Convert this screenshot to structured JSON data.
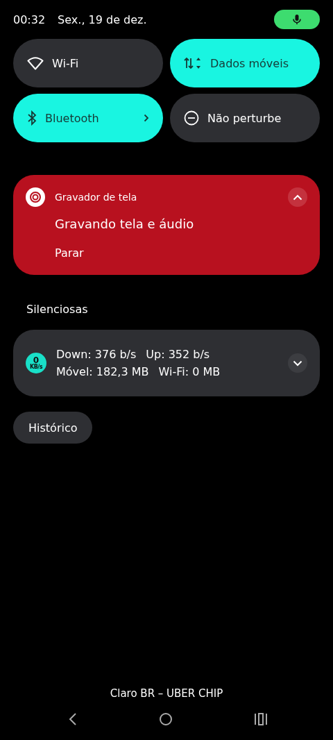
{
  "status_bar": {
    "time": "00:32",
    "date": "Sex., 19 de dez.",
    "mic_active": true
  },
  "tiles": [
    {
      "kind": "wifi",
      "label": "Wi-Fi",
      "on": false,
      "chevron": false
    },
    {
      "kind": "data",
      "label": "Dados móveis",
      "on": true,
      "chevron": false
    },
    {
      "kind": "bluetooth",
      "label": "Bluetooth",
      "on": true,
      "chevron": true
    },
    {
      "kind": "dnd",
      "label": "Não perturbe",
      "on": false,
      "chevron": false
    }
  ],
  "recording_notification": {
    "app": "Gravador de tela",
    "title": "Gravando tela e áudio",
    "action": "Parar",
    "expanded": true
  },
  "section_title": "Silenciosas",
  "speed_notification": {
    "badge_value": "0",
    "badge_unit": "KB/s",
    "line_1": [
      "Down: 376 b/s",
      "Up: 352 b/s"
    ],
    "line_2": [
      "Móvel: 182,3 MB",
      "Wi-Fi: 0 MB"
    ],
    "expanded": false
  },
  "history_button": "Histórico",
  "carrier": "Claro BR – UBER CHIP"
}
